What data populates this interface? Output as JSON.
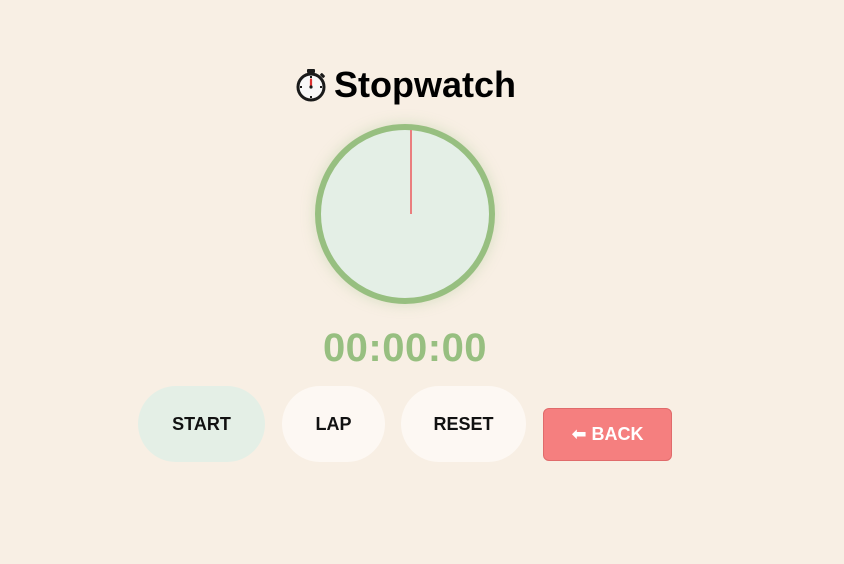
{
  "header": {
    "icon": "stopwatch-icon",
    "title": "Stopwatch"
  },
  "stopwatch": {
    "display": "00:00:00",
    "hand_seconds": 0
  },
  "controls": {
    "start_label": "START",
    "lap_label": "LAP",
    "reset_label": "RESET",
    "back_label": "⬅ BACK"
  },
  "colors": {
    "background": "#f8efe4",
    "accent_green": "#97bf80",
    "dial_fill": "#e4efe6",
    "hand_red": "#ea7e7e",
    "back_button": "#f57f7f"
  }
}
